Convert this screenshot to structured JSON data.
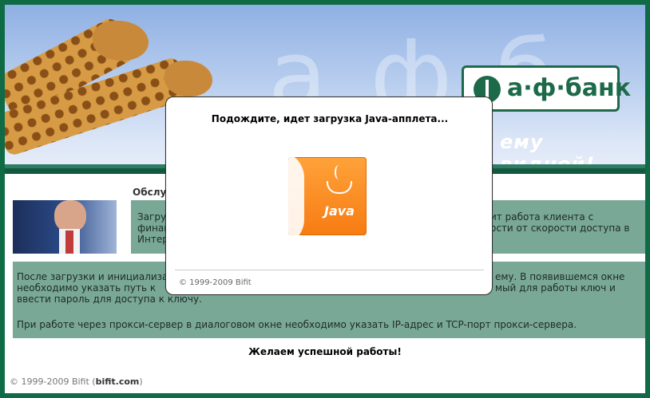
{
  "banner": {
    "logo_text": "а·ф·банк",
    "slogan": "ему видней!"
  },
  "content": {
    "section_title": "Обслуживание",
    "box1_lines": [
      "Загрузка",
      "финансовой",
      "Интернет"
    ],
    "box1_right_lines": [
      "ит работа клиента с",
      "ости от скорости доступа в"
    ],
    "box2_line1": "После загрузки и инициализации",
    "box2_line1_right": "ему. В появившемся окне",
    "box2_line2": "необходимо указать путь к",
    "box2_line2_right": "мый для работы ключ и",
    "box2_line3": "ввести пароль для доступа к ключу.",
    "box2_line4": "При работе через прокси-сервер в диалоговом окне необходимо указать IP-адрес и TCP-порт прокси-сервера.",
    "wish": "Желаем успешной работы!"
  },
  "footer": {
    "copyright": "© 1999-2009 Bifit (",
    "link": "bifit.com",
    "close": ")"
  },
  "modal": {
    "title": "Подождите, идет загрузка Java-апплета...",
    "java_word": "Java",
    "footer": "© 1999-2009 Bifit"
  },
  "colors": {
    "frame": "#0e6b45",
    "box": "#7aa897",
    "java_orange": "#f67c12"
  }
}
